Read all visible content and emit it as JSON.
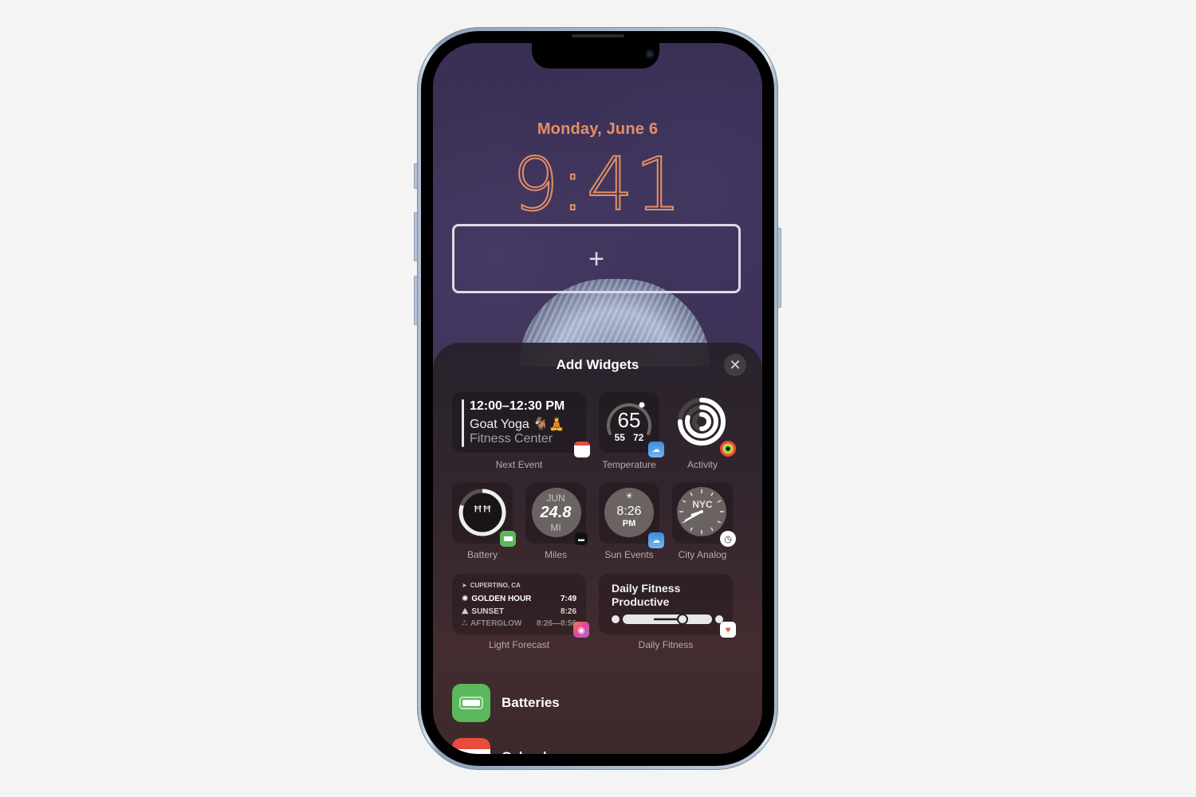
{
  "lock_screen": {
    "date": "Monday, June 6",
    "time": "9:41",
    "add_widget_slot_icon": "plus-icon"
  },
  "sheet": {
    "title": "Add Widgets",
    "close_icon": "✕",
    "widgets": {
      "next_event": {
        "label": "Next Event",
        "time": "12:00–12:30 PM",
        "title": "Goat Yoga 🐐🧘",
        "location": "Fitness Center",
        "app_icon": "calendar-icon"
      },
      "temperature": {
        "label": "Temperature",
        "current": "65",
        "low": "55",
        "high": "72",
        "gauge_fraction": 0.6,
        "app_icon": "weather-icon"
      },
      "activity": {
        "label": "Activity",
        "app_icon": "fitness-rings-icon",
        "rings": [
          0.75,
          0.8,
          0.5
        ]
      },
      "battery": {
        "label": "Battery",
        "level_fraction": 0.8,
        "device_icon": "airpods-icon",
        "app_icon": "battery-app-icon"
      },
      "miles": {
        "label": "Miles",
        "month": "JUN",
        "value": "24.8",
        "unit": "MI",
        "app_icon": "activity-tracker-icon"
      },
      "sun_events": {
        "label": "Sun Events",
        "time": "8:26",
        "period": "PM",
        "app_icon": "weather-icon"
      },
      "city_analog": {
        "label": "City Analog",
        "city": "NYC",
        "app_icon": "clock-icon"
      },
      "light_forecast": {
        "label": "Light Forecast",
        "location": "CUPERTINO, CA",
        "rows": [
          {
            "name": "GOLDEN HOUR",
            "value": "7:49",
            "icon": "sun-icon"
          },
          {
            "name": "SUNSET",
            "value": "8:26",
            "icon": "sunset-icon"
          },
          {
            "name": "AFTERGLOW",
            "value": "8:26—8:56",
            "icon": "afterglow-icon"
          }
        ],
        "app_icon": "light-forecast-app-icon"
      },
      "daily_fitness": {
        "label": "Daily Fitness",
        "line1": "Daily Fitness",
        "line2": "Productive",
        "slider_fraction": 0.6,
        "app_icon": "heart-app-icon"
      }
    },
    "apps": [
      {
        "name": "Batteries",
        "icon": "battery-app-icon",
        "color": "#5cb85c"
      },
      {
        "name": "Calendar",
        "icon": "calendar-app-icon",
        "color": "#e84c3d"
      }
    ]
  },
  "colors": {
    "accent": "#e39066",
    "wallpaper": "#3b2f55",
    "battery_green": "#5cb85c"
  }
}
